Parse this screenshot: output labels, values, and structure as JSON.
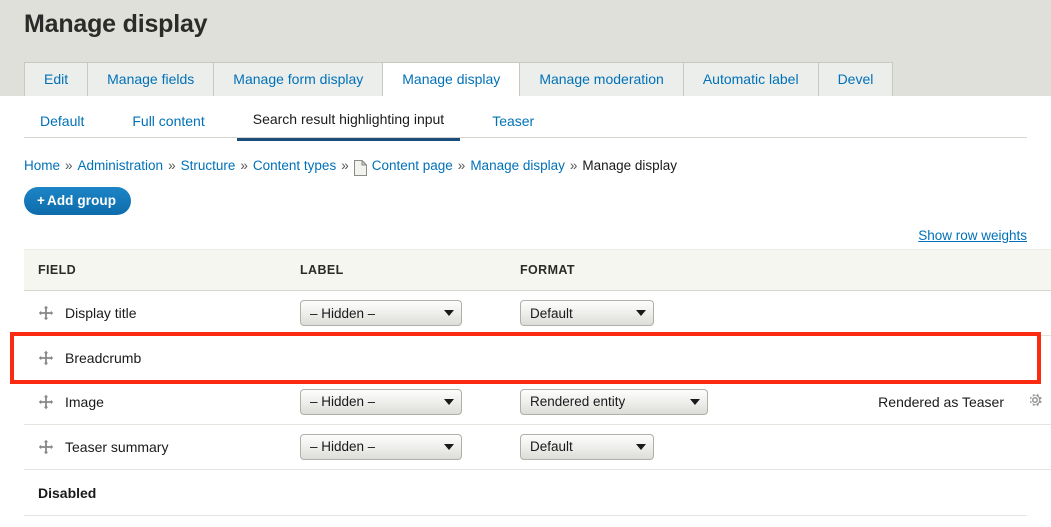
{
  "header": {
    "title": "Manage display"
  },
  "primary_tabs": [
    {
      "label": "Edit",
      "active": false
    },
    {
      "label": "Manage fields",
      "active": false
    },
    {
      "label": "Manage form display",
      "active": false
    },
    {
      "label": "Manage display",
      "active": true
    },
    {
      "label": "Manage moderation",
      "active": false
    },
    {
      "label": "Automatic label",
      "active": false
    },
    {
      "label": "Devel",
      "active": false
    }
  ],
  "secondary_tabs": [
    {
      "label": "Default",
      "active": false
    },
    {
      "label": "Full content",
      "active": false
    },
    {
      "label": "Search result highlighting input",
      "active": true
    },
    {
      "label": "Teaser",
      "active": false
    }
  ],
  "breadcrumb": {
    "items": [
      {
        "label": "Home",
        "link": true,
        "icon": null
      },
      {
        "label": "Administration",
        "link": true,
        "icon": null
      },
      {
        "label": "Structure",
        "link": true,
        "icon": null
      },
      {
        "label": "Content types",
        "link": true,
        "icon": null
      },
      {
        "label": "Content page",
        "link": true,
        "icon": "page-icon"
      },
      {
        "label": "Manage display",
        "link": true,
        "icon": null
      },
      {
        "label": "Manage display",
        "link": false,
        "icon": null
      }
    ],
    "separator": "»"
  },
  "actions": {
    "add_group_label": "Add group",
    "add_group_plus": "+",
    "show_row_weights_label": "Show row weights"
  },
  "table": {
    "columns": [
      "FIELD",
      "LABEL",
      "FORMAT"
    ],
    "rows": [
      {
        "field": "Display title",
        "label_select": "– Hidden –",
        "format_select": "Default",
        "summary": "",
        "has_settings": false,
        "highlighted": false
      },
      {
        "field": "Breadcrumb",
        "label_select": "",
        "format_select": "",
        "summary": "",
        "has_settings": false,
        "highlighted": true
      },
      {
        "field": "Image",
        "label_select": "– Hidden –",
        "format_select": "Rendered entity",
        "summary": "Rendered as Teaser",
        "has_settings": true,
        "highlighted": false
      },
      {
        "field": "Teaser summary",
        "label_select": "– Hidden –",
        "format_select": "Default",
        "summary": "",
        "has_settings": false,
        "highlighted": false
      }
    ],
    "disabled_section_label": "Disabled"
  },
  "colors": {
    "link": "#0071b8",
    "header_band": "#e0e0da",
    "highlight_border": "#fb2b12",
    "button_blue": "#0e6cab",
    "active_tab_underline": "#1a4d7a"
  },
  "icons": {
    "drag": "drag-handle-icon",
    "gear": "gear-icon",
    "page": "page-icon"
  }
}
